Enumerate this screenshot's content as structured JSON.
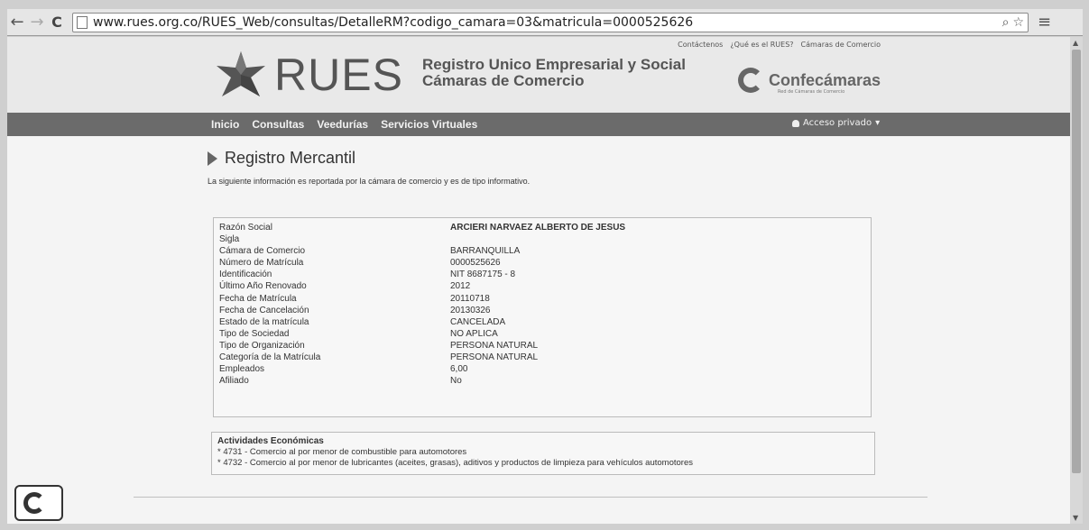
{
  "browser": {
    "url": "www.rues.org.co/RUES_Web/consultas/DetalleRM?codigo_camara=03&matricula=0000525626"
  },
  "header": {
    "top_links": [
      "Contáctenos",
      "¿Qué es el RUES?",
      "Cámaras de Comercio"
    ],
    "logo_text": "RUES",
    "tagline_line1": "Registro Unico Empresarial y Social",
    "tagline_line2": "Cámaras de Comercio",
    "partner_name": "Confecámaras",
    "partner_sub": "Red de Cámaras de Comercio"
  },
  "nav": {
    "items": [
      "Inicio",
      "Consultas",
      "Veedurías",
      "Servicios Virtuales"
    ],
    "private_access": "Acceso privado"
  },
  "main": {
    "title": "Registro Mercantil",
    "intro": "La siguiente información es reportada por la cámara de comercio y es de tipo informativo.",
    "fields": [
      {
        "label": "Razón Social",
        "value": "ARCIERI NARVAEZ ALBERTO DE JESUS"
      },
      {
        "label": "Sigla",
        "value": ""
      },
      {
        "label": "Cámara de Comercio",
        "value": "BARRANQUILLA"
      },
      {
        "label": "Número de Matrícula",
        "value": "0000525626"
      },
      {
        "label": "Identificación",
        "value": "NIT 8687175 - 8"
      },
      {
        "label": "Último Año Renovado",
        "value": "2012"
      },
      {
        "label": "Fecha de Matrícula",
        "value": "20110718"
      },
      {
        "label": "Fecha de Cancelación",
        "value": "20130326"
      },
      {
        "label": "Estado de la matrícula",
        "value": "CANCELADA"
      },
      {
        "label": "Tipo de Sociedad",
        "value": "NO APLICA"
      },
      {
        "label": "Tipo de Organización",
        "value": "PERSONA NATURAL"
      },
      {
        "label": "Categoría de la Matrícula",
        "value": "PERSONA NATURAL"
      },
      {
        "label": "Empleados",
        "value": "6,00"
      },
      {
        "label": "Afiliado",
        "value": "No"
      }
    ],
    "activities_title": "Actividades Económicas",
    "activities": [
      "* 4731 - Comercio al por menor de combustible para automotores",
      "* 4732 - Comercio al por menor de lubricantes (aceites, grasas), aditivos y productos de limpieza para vehículos automotores"
    ]
  }
}
